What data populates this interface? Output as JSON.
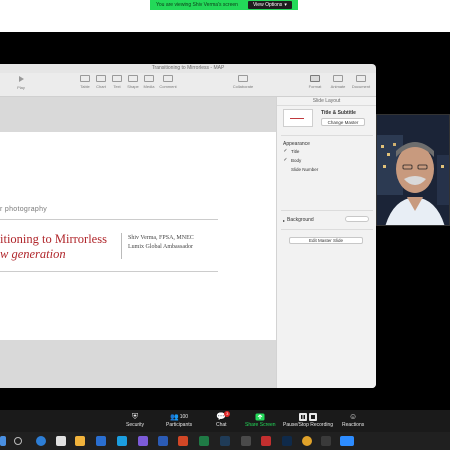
{
  "sharing_banner": {
    "text": "You are viewing Shiv Verma's screen",
    "view_options": "View Options"
  },
  "keynote": {
    "window_title": "Transitioning to Mirrorless - MAP",
    "toolbar": {
      "play": "Play",
      "table": "Table",
      "chart": "Chart",
      "text": "Text",
      "shape": "Shape",
      "media": "Media",
      "comment": "Comment",
      "collaborate": "Collaborate",
      "format": "Format",
      "animate": "Animate",
      "document": "Document"
    },
    "slide": {
      "subtitle": "r photography",
      "title_line1": "itioning to Mirrorless",
      "title_line2": "w generation",
      "author_name": "Shiv Verma, FPSA, MNEC",
      "author_role": "Lumix Global Ambassador"
    },
    "inspector": {
      "header": "Slide Layout",
      "layout_name": "Title & Subtitle",
      "change_master": "Change Master",
      "appearance_label": "Appearance",
      "options": [
        {
          "label": "Title",
          "checked": true
        },
        {
          "label": "Body",
          "checked": true
        },
        {
          "label": "Slide Number",
          "checked": false
        }
      ],
      "background_label": "Background",
      "edit_master": "Edit Master Slide"
    }
  },
  "zoom_controls": {
    "security": "Security",
    "participants": "Participants",
    "participants_count": "100",
    "chat": "Chat",
    "chat_badge": "3",
    "share_screen": "Share Screen",
    "pause_recording": "Pause/Stop Recording",
    "reactions": "Reactions"
  },
  "colors": {
    "accent_green": "#23d959",
    "slide_title_red": "#b0262b",
    "zoom_bar": "#1a1a1a",
    "taskbar": "#202020"
  }
}
